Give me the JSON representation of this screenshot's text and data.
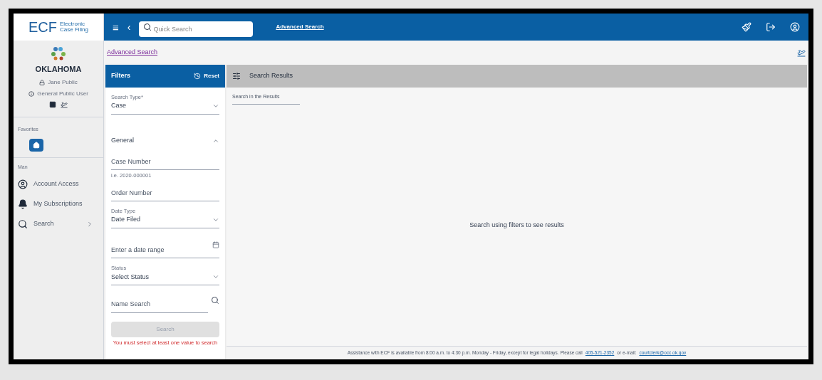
{
  "logo": {
    "short": "ECF",
    "long_1": "Electronic",
    "long_2": "Case Filing"
  },
  "topbar": {
    "menu": "≡",
    "collapse": "‹",
    "search_placeholder": "Quick Search",
    "advanced_link": "Advanced Search"
  },
  "sidebar": {
    "state": "OKLAHOMA",
    "user": "Jane Public",
    "role": "General Public User",
    "favorites_label": "Favorites",
    "main_label": "Man",
    "items": [
      {
        "kind": "account",
        "label": "Account Access",
        "expandable": false
      },
      {
        "kind": "bell",
        "label": "My Subscriptions",
        "expandable": false
      },
      {
        "kind": "search",
        "label": "Search",
        "expandable": true
      }
    ]
  },
  "breadcrumb": "Advanced Search",
  "filters": {
    "title": "Filters",
    "reset": "Reset",
    "search_type_label": "Search Type*",
    "search_type_value": "Case",
    "section": "General",
    "section_expanded": true,
    "case_number_placeholder": "Case Number",
    "case_number_hint": "i.e. 2020-000001",
    "order_number_placeholder": "Order Number",
    "date_type_label": "Date Type",
    "date_type_value": "Date Filed",
    "date_range_placeholder": "Enter a date range",
    "status_label": "Status",
    "status_value": "Select Status",
    "name_placeholder": "Name Search",
    "search_button": "Search",
    "search_disabled": true,
    "error": "You must select at least one value to search"
  },
  "results": {
    "title": "Search Results",
    "filter_placeholder": "Search in the Results",
    "empty": "Search using filters to see results"
  },
  "footer": {
    "text": "Assistance with ECF is available from 8:00 a.m. to 4:30 p.m. Monday - Friday, except for legal holidays. Please call",
    "phone": "405-521-2352",
    "mid": "or e-mail:",
    "email": "courtclerk@occ.ok.gov"
  }
}
